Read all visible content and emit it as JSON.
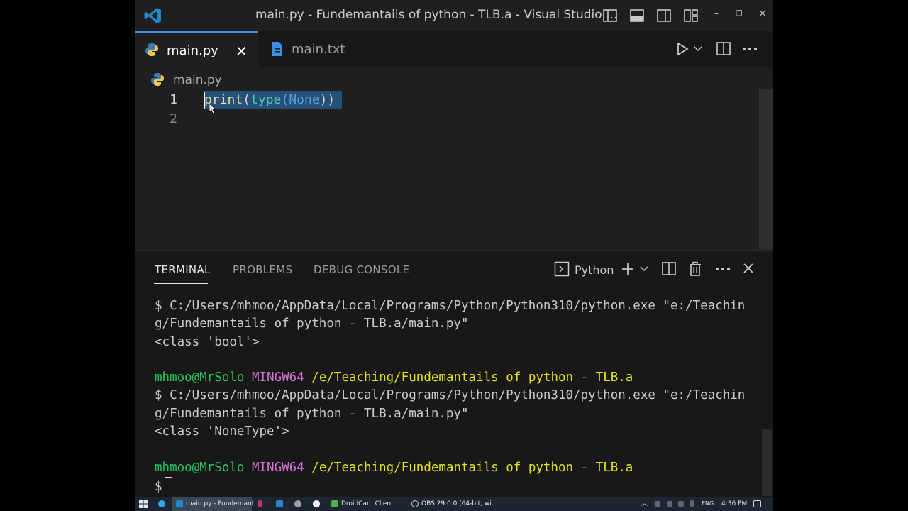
{
  "window": {
    "title": "main.py - Fundemantails of python - TLB.a - Visual Studio ...",
    "minimize": "–",
    "restore": "❐",
    "close": "✕"
  },
  "tabs": [
    {
      "label": "main.py",
      "close": "✕"
    },
    {
      "label": "main.txt"
    }
  ],
  "breadcrumb": "main.py",
  "editor": {
    "line_numbers": [
      "1",
      "2"
    ],
    "code": {
      "fn": "print",
      "open1": "(",
      "builtin": "type",
      "open2": "(",
      "keyword": "None",
      "close": "))"
    }
  },
  "panel": {
    "tabs": [
      "TERMINAL",
      "PROBLEMS",
      "DEBUG CONSOLE"
    ],
    "shell_label": "Python",
    "lines": {
      "cmd1a": "$ C:/Users/mhmoo/AppData/Local/Programs/Python/Python310/python.exe \"e:/Teachin",
      "cmd1b": "g/Fundemantails of python - TLB.a/main.py\"",
      "out1": "<class 'bool'>",
      "user": "mhmoo@MrSolo",
      "env": "MINGW64",
      "path": "/e/Teaching/Fundemantails of python - TLB.a",
      "cmd2a": "$ C:/Users/mhmoo/AppData/Local/Programs/Python/Python310/python.exe \"e:/Teachin",
      "cmd2b": "g/Fundemantails of python - TLB.a/main.py\"",
      "out2": "<class 'NoneType'>",
      "prompt": "$"
    }
  },
  "taskbar": {
    "items": [
      "main.py - Fundemant...",
      "DroidCam Client",
      "OBS 29.0.0 (64-bit, wi..."
    ],
    "lang": "ENG",
    "time": "4:36 PM"
  },
  "colors": {
    "accent": "#3b8eea",
    "selection": "#264f78",
    "prompt_user": "#22c55e",
    "prompt_env": "#d670d6",
    "prompt_path": "#e5e510"
  }
}
